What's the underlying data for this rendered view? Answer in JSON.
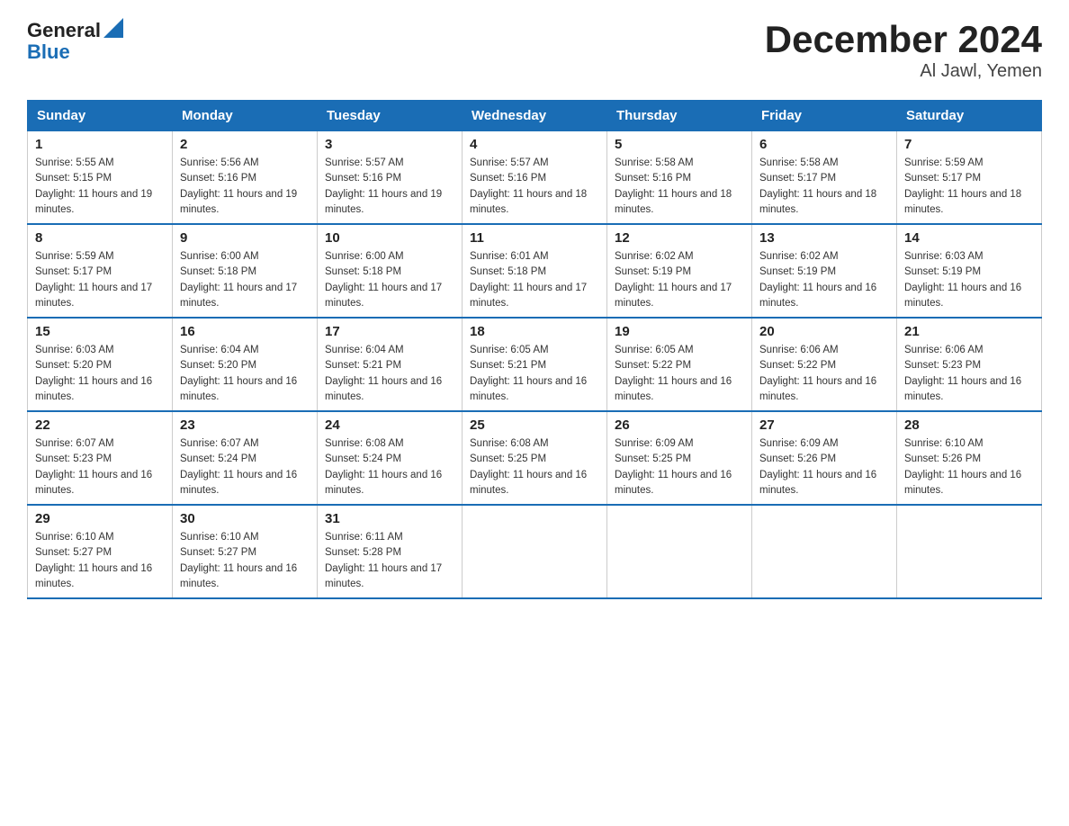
{
  "header": {
    "logo_general": "General",
    "logo_blue": "Blue",
    "title": "December 2024",
    "subtitle": "Al Jawl, Yemen"
  },
  "calendar": {
    "days_of_week": [
      "Sunday",
      "Monday",
      "Tuesday",
      "Wednesday",
      "Thursday",
      "Friday",
      "Saturday"
    ],
    "weeks": [
      [
        {
          "day": "1",
          "sunrise": "5:55 AM",
          "sunset": "5:15 PM",
          "daylight": "11 hours and 19 minutes."
        },
        {
          "day": "2",
          "sunrise": "5:56 AM",
          "sunset": "5:16 PM",
          "daylight": "11 hours and 19 minutes."
        },
        {
          "day": "3",
          "sunrise": "5:57 AM",
          "sunset": "5:16 PM",
          "daylight": "11 hours and 19 minutes."
        },
        {
          "day": "4",
          "sunrise": "5:57 AM",
          "sunset": "5:16 PM",
          "daylight": "11 hours and 18 minutes."
        },
        {
          "day": "5",
          "sunrise": "5:58 AM",
          "sunset": "5:16 PM",
          "daylight": "11 hours and 18 minutes."
        },
        {
          "day": "6",
          "sunrise": "5:58 AM",
          "sunset": "5:17 PM",
          "daylight": "11 hours and 18 minutes."
        },
        {
          "day": "7",
          "sunrise": "5:59 AM",
          "sunset": "5:17 PM",
          "daylight": "11 hours and 18 minutes."
        }
      ],
      [
        {
          "day": "8",
          "sunrise": "5:59 AM",
          "sunset": "5:17 PM",
          "daylight": "11 hours and 17 minutes."
        },
        {
          "day": "9",
          "sunrise": "6:00 AM",
          "sunset": "5:18 PM",
          "daylight": "11 hours and 17 minutes."
        },
        {
          "day": "10",
          "sunrise": "6:00 AM",
          "sunset": "5:18 PM",
          "daylight": "11 hours and 17 minutes."
        },
        {
          "day": "11",
          "sunrise": "6:01 AM",
          "sunset": "5:18 PM",
          "daylight": "11 hours and 17 minutes."
        },
        {
          "day": "12",
          "sunrise": "6:02 AM",
          "sunset": "5:19 PM",
          "daylight": "11 hours and 17 minutes."
        },
        {
          "day": "13",
          "sunrise": "6:02 AM",
          "sunset": "5:19 PM",
          "daylight": "11 hours and 16 minutes."
        },
        {
          "day": "14",
          "sunrise": "6:03 AM",
          "sunset": "5:19 PM",
          "daylight": "11 hours and 16 minutes."
        }
      ],
      [
        {
          "day": "15",
          "sunrise": "6:03 AM",
          "sunset": "5:20 PM",
          "daylight": "11 hours and 16 minutes."
        },
        {
          "day": "16",
          "sunrise": "6:04 AM",
          "sunset": "5:20 PM",
          "daylight": "11 hours and 16 minutes."
        },
        {
          "day": "17",
          "sunrise": "6:04 AM",
          "sunset": "5:21 PM",
          "daylight": "11 hours and 16 minutes."
        },
        {
          "day": "18",
          "sunrise": "6:05 AM",
          "sunset": "5:21 PM",
          "daylight": "11 hours and 16 minutes."
        },
        {
          "day": "19",
          "sunrise": "6:05 AM",
          "sunset": "5:22 PM",
          "daylight": "11 hours and 16 minutes."
        },
        {
          "day": "20",
          "sunrise": "6:06 AM",
          "sunset": "5:22 PM",
          "daylight": "11 hours and 16 minutes."
        },
        {
          "day": "21",
          "sunrise": "6:06 AM",
          "sunset": "5:23 PM",
          "daylight": "11 hours and 16 minutes."
        }
      ],
      [
        {
          "day": "22",
          "sunrise": "6:07 AM",
          "sunset": "5:23 PM",
          "daylight": "11 hours and 16 minutes."
        },
        {
          "day": "23",
          "sunrise": "6:07 AM",
          "sunset": "5:24 PM",
          "daylight": "11 hours and 16 minutes."
        },
        {
          "day": "24",
          "sunrise": "6:08 AM",
          "sunset": "5:24 PM",
          "daylight": "11 hours and 16 minutes."
        },
        {
          "day": "25",
          "sunrise": "6:08 AM",
          "sunset": "5:25 PM",
          "daylight": "11 hours and 16 minutes."
        },
        {
          "day": "26",
          "sunrise": "6:09 AM",
          "sunset": "5:25 PM",
          "daylight": "11 hours and 16 minutes."
        },
        {
          "day": "27",
          "sunrise": "6:09 AM",
          "sunset": "5:26 PM",
          "daylight": "11 hours and 16 minutes."
        },
        {
          "day": "28",
          "sunrise": "6:10 AM",
          "sunset": "5:26 PM",
          "daylight": "11 hours and 16 minutes."
        }
      ],
      [
        {
          "day": "29",
          "sunrise": "6:10 AM",
          "sunset": "5:27 PM",
          "daylight": "11 hours and 16 minutes."
        },
        {
          "day": "30",
          "sunrise": "6:10 AM",
          "sunset": "5:27 PM",
          "daylight": "11 hours and 16 minutes."
        },
        {
          "day": "31",
          "sunrise": "6:11 AM",
          "sunset": "5:28 PM",
          "daylight": "11 hours and 17 minutes."
        },
        null,
        null,
        null,
        null
      ]
    ]
  }
}
